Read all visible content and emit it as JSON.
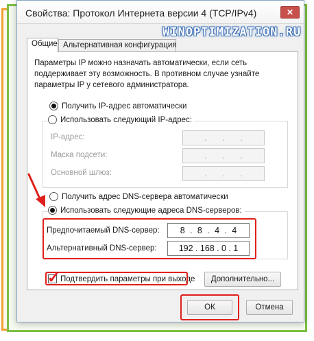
{
  "window": {
    "title": "Свойства: Протокол Интернета версии 4 (TCP/IPv4)",
    "close_symbol": "✕",
    "watermark": "WINOPTIMIZATION.RU"
  },
  "tabs": [
    {
      "label": "Общие",
      "active": true
    },
    {
      "label": "Альтернативная конфигурация",
      "active": false
    }
  ],
  "description": "Параметры IP можно назначать автоматически, если сеть поддерживает эту возможность. В противном случае узнайте параметры IP у сетевого администратора.",
  "ip": {
    "auto_label": "Получить IP-адрес автоматически",
    "auto_checked": true,
    "manual_label": "Использовать следующий IP-адрес:",
    "manual_checked": false,
    "fields": [
      {
        "label": "IP-адрес:",
        "octets": [
          "",
          "",
          "",
          ""
        ]
      },
      {
        "label": "Маска подсети:",
        "octets": [
          "",
          "",
          "",
          ""
        ]
      },
      {
        "label": "Основной шлюз:",
        "octets": [
          "",
          "",
          "",
          ""
        ]
      }
    ]
  },
  "dns": {
    "auto_label": "Получить адрес DNS-сервера автоматически",
    "auto_checked": false,
    "manual_label": "Использовать следующие адреса DNS-серверов:",
    "manual_checked": true,
    "preferred_label": "Предпочитаемый DNS-сервер:",
    "preferred_octets": [
      "8",
      "8",
      "4",
      "4"
    ],
    "alternate_label": "Альтернативный DNS-сервер:",
    "alternate_octets": [
      "192",
      "168",
      "0",
      "1"
    ]
  },
  "validate": {
    "label": "Подтвердить параметры при выходе",
    "checked": true
  },
  "buttons": {
    "advanced": "Дополнительно...",
    "ok": "ОК",
    "cancel": "Отмена"
  },
  "colors": {
    "highlight": "#e0201c",
    "accent_orange": "#f0a030",
    "accent_green": "#7cc043"
  }
}
